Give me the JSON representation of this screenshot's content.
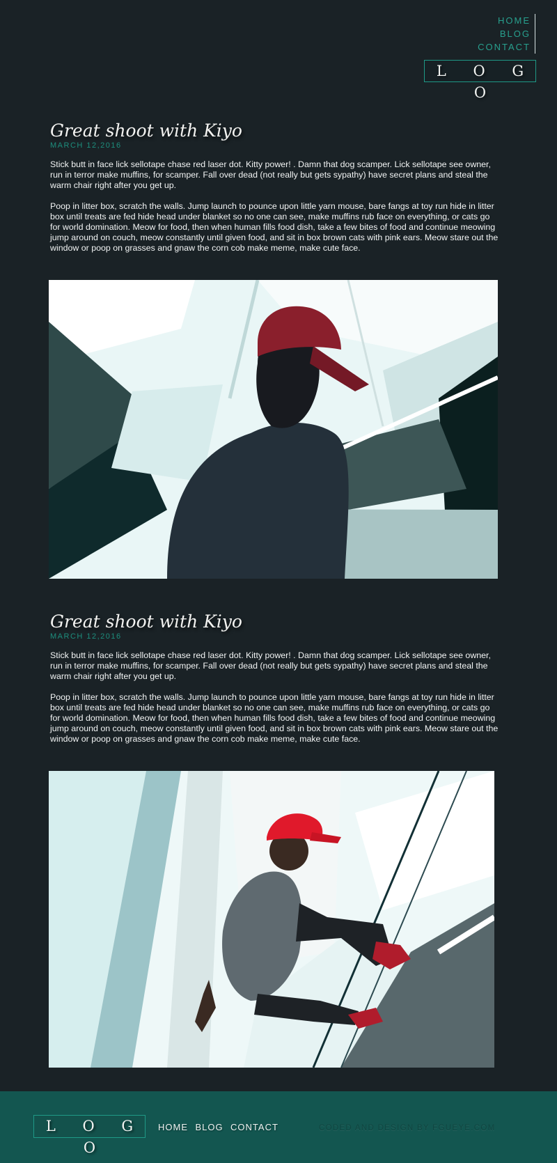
{
  "nav": {
    "items": [
      {
        "label": "HOME"
      },
      {
        "label": "BLOG"
      },
      {
        "label": "CONTACT"
      }
    ]
  },
  "header": {
    "logo_text": "L O G O"
  },
  "posts": [
    {
      "title": "Great shoot with Kiyo",
      "date": "MARCH 12,2016",
      "paragraphs": [
        "Stick butt in face lick sellotape chase red laser dot. Kitty power! . Damn that dog scamper. Lick sellotape see owner, run in terror make muffins, for scamper. Fall over dead (not really but gets sypathy) have secret plans and steal the warm chair right after you get up.",
        "Poop in litter box, scratch the walls. Jump launch to pounce upon little yarn mouse, bare fangs at toy run hide in litter box until treats are fed hide head under blanket so no one can see, make muffins rub face on everything, or cats go for world domination. Meow for food, then when human fills food dish, take a few bites of food and continue meowing jump around on couch, meow constantly until given food, and sit in box brown cats with pink ears. Meow stare out the window or poop on grasses and gnaw the corn cob make meme, make cute face."
      ]
    },
    {
      "title": "Great shoot with Kiyo",
      "date": "MARCH 12,2016",
      "paragraphs": [
        "Stick butt in face lick sellotape chase red laser dot. Kitty power! . Damn that dog scamper. Lick sellotape see owner, run in terror make muffins, for scamper. Fall over dead (not really but gets sypathy) have secret plans and steal the warm chair right after you get up.",
        "Poop in litter box, scratch the walls. Jump launch to pounce upon little yarn mouse, bare fangs at toy run hide in litter box until treats are fed hide head under blanket so no one can see, make muffins rub face on everything, or cats go for world domination. Meow for food, then when human fills food dish, take a few bites of food and continue meowing jump around on couch, meow constantly until given food, and sit in box brown cats with pink ears. Meow stare out the window or poop on grasses and gnaw the corn cob make meme, make cute face."
      ]
    }
  ],
  "footer": {
    "logo_text": "L O G O",
    "nav": [
      {
        "label": "HOME"
      },
      {
        "label": "BLOG"
      },
      {
        "label": "CONTACT"
      }
    ],
    "credit": "CODED AND DESIGN BY FGUEYE.COM"
  },
  "colors": {
    "background": "#1a2226",
    "accent": "#28a08e",
    "footer_bg": "#135650",
    "text": "#f2f4f4"
  }
}
